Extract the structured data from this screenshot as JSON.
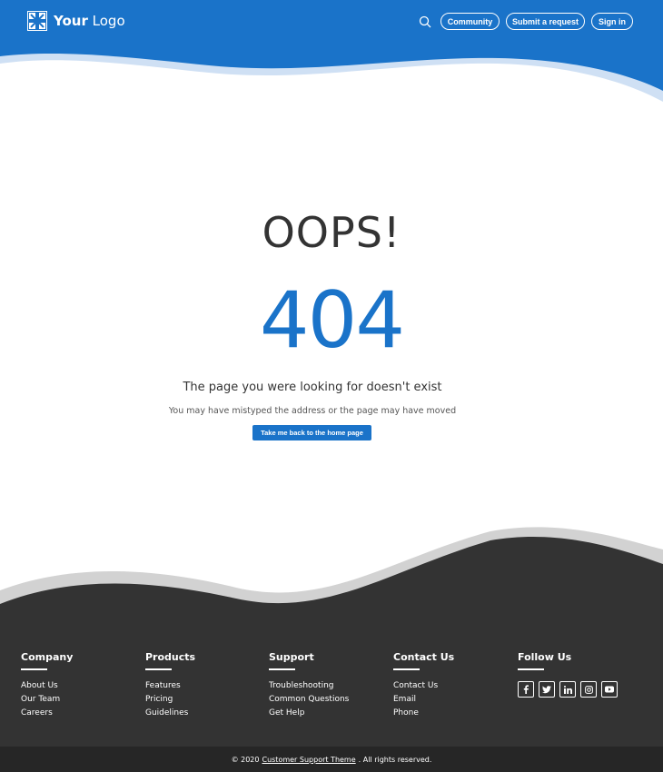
{
  "header": {
    "logo_bold": "Your",
    "logo_light": "Logo",
    "nav": [
      "Community",
      "Submit a request",
      "Sign in"
    ]
  },
  "main": {
    "oops": "OOPS!",
    "code": "404",
    "message": "The page you were looking for doesn't exist",
    "submessage": "You may have mistyped the address or the page may have moved",
    "button": "Take me back to the home page"
  },
  "footer": {
    "columns": [
      {
        "title": "Company",
        "links": [
          "About Us",
          "Our Team",
          "Careers"
        ]
      },
      {
        "title": "Products",
        "links": [
          "Features",
          "Pricing",
          "Guidelines"
        ]
      },
      {
        "title": "Support",
        "links": [
          "Troubleshooting",
          "Common Questions",
          "Get Help"
        ]
      },
      {
        "title": "Contact Us",
        "links": [
          "Contact Us",
          "Email",
          "Phone"
        ]
      }
    ],
    "follow_title": "Follow Us",
    "social_icons": [
      "facebook-icon",
      "twitter-icon",
      "linkedin-icon",
      "instagram-icon",
      "youtube-icon"
    ],
    "copyright_prefix": "© 2020",
    "copyright_link": "Customer Support Theme",
    "copyright_suffix": ". All rights reserved."
  },
  "colors": {
    "brand_blue": "#1a73c9",
    "footer_dark": "#333333",
    "bottom_bar": "#262626"
  }
}
